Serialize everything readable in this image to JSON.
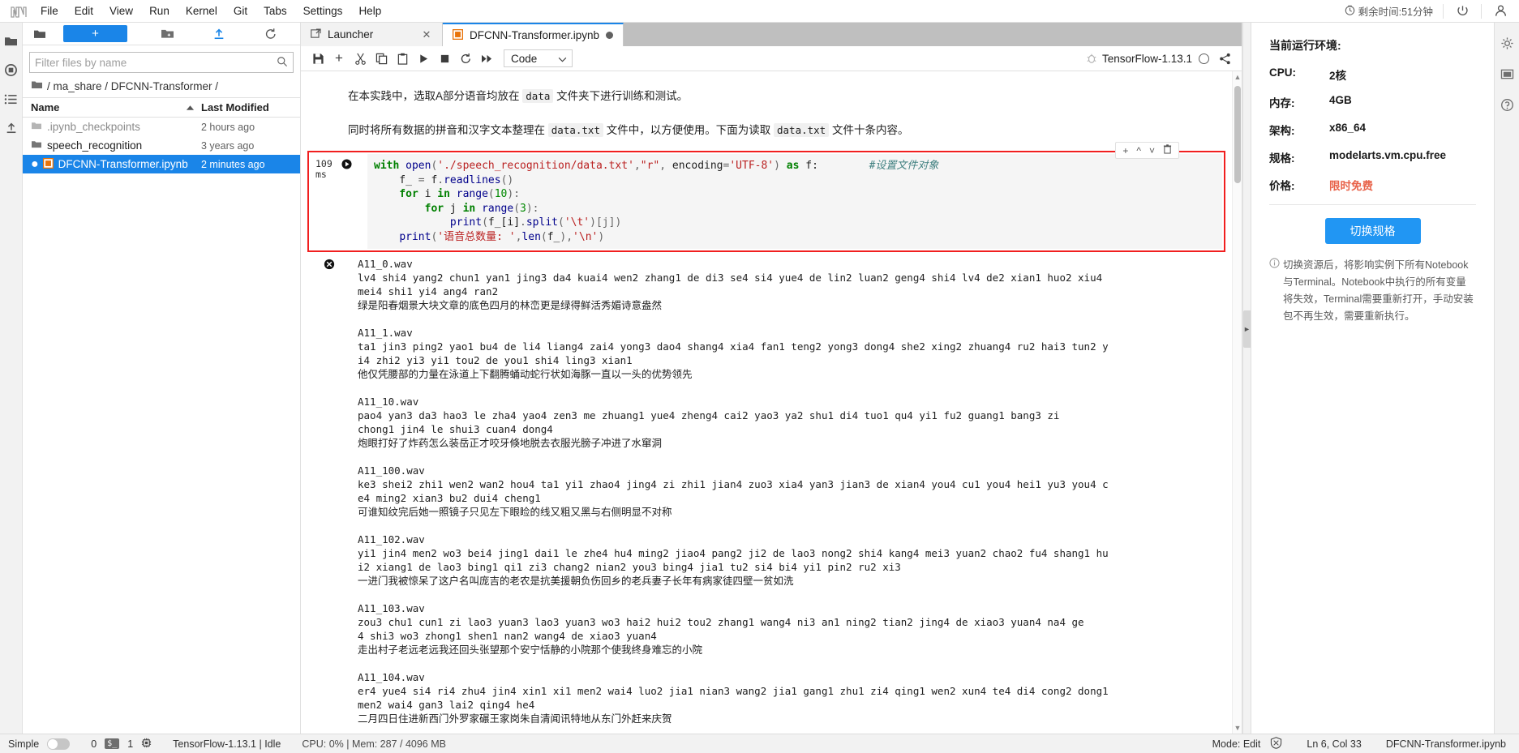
{
  "menubar": {
    "items": [
      "File",
      "Edit",
      "View",
      "Run",
      "Kernel",
      "Git",
      "Tabs",
      "Settings",
      "Help"
    ],
    "timer": "剩余时间:51分钟"
  },
  "filebrowser": {
    "new_button_label": "+",
    "filter_placeholder": "Filter files by name",
    "breadcrumb": "/ ma_share / DFCNN-Transformer /",
    "columns": {
      "name": "Name",
      "modified": "Last Modified"
    },
    "rows": [
      {
        "name": ".ipynb_checkpoints",
        "modified": "2 hours ago",
        "type": "folder",
        "selected": false,
        "dirty": false
      },
      {
        "name": "speech_recognition",
        "modified": "3 years ago",
        "type": "folder",
        "selected": false,
        "dirty": false
      },
      {
        "name": "DFCNN-Transformer.ipynb",
        "modified": "2 minutes ago",
        "type": "notebook",
        "selected": true,
        "dirty": true
      }
    ]
  },
  "tabs": [
    {
      "label": "Launcher",
      "active": false,
      "closable": true
    },
    {
      "label": "DFCNN-Transformer.ipynb",
      "active": true,
      "closable": false,
      "dirty": true
    }
  ],
  "notebook_toolbar": {
    "cell_type": "Code",
    "kernel_name": "TensorFlow-1.13.1"
  },
  "notebook": {
    "markdown_cells": [
      {
        "parts": [
          {
            "t": "text",
            "v": "在本实践中，选取A部分语音均放在 "
          },
          {
            "t": "code",
            "v": "data"
          },
          {
            "t": "text",
            "v": " 文件夹下进行训练和测试。"
          }
        ]
      },
      {
        "parts": [
          {
            "t": "text",
            "v": "同时将所有数据的拼音和汉字文本整理在 "
          },
          {
            "t": "code",
            "v": "data.txt"
          },
          {
            "t": "text",
            "v": " 文件中，以方便使用。下面为读取 "
          },
          {
            "t": "code",
            "v": "data.txt"
          },
          {
            "t": "text",
            "v": " 文件十条内容。"
          }
        ]
      }
    ],
    "code_cell": {
      "exec_time_value": "109",
      "exec_time_unit": "ms",
      "toolbar_icons": [
        "+",
        "^",
        "v",
        "trash"
      ],
      "lines": [
        [
          {
            "t": "kw",
            "v": "with "
          },
          {
            "t": "fn",
            "v": "open"
          },
          {
            "t": "op",
            "v": "("
          },
          {
            "t": "str",
            "v": "'./speech_recognition/data.txt'"
          },
          {
            "t": "op",
            "v": ","
          },
          {
            "t": "str",
            "v": "\"r\""
          },
          {
            "t": "op",
            "v": ", "
          },
          {
            "t": "pl",
            "v": "encoding"
          },
          {
            "t": "op",
            "v": "="
          },
          {
            "t": "str",
            "v": "'UTF-8'"
          },
          {
            "t": "op",
            "v": ") "
          },
          {
            "t": "kw",
            "v": "as"
          },
          {
            "t": "pl",
            "v": " f:"
          },
          {
            "t": "pl",
            "v": "        "
          },
          {
            "t": "cm",
            "v": "#设置文件对象"
          }
        ],
        [
          {
            "t": "pl",
            "v": "    f_ "
          },
          {
            "t": "op",
            "v": "="
          },
          {
            "t": "pl",
            "v": " f"
          },
          {
            "t": "op",
            "v": "."
          },
          {
            "t": "fn",
            "v": "readlines"
          },
          {
            "t": "op",
            "v": "()"
          }
        ],
        [
          {
            "t": "kw",
            "v": "    for"
          },
          {
            "t": "pl",
            "v": " i "
          },
          {
            "t": "kw",
            "v": "in"
          },
          {
            "t": "pl",
            "v": " "
          },
          {
            "t": "fn",
            "v": "range"
          },
          {
            "t": "op",
            "v": "("
          },
          {
            "t": "num",
            "v": "10"
          },
          {
            "t": "op",
            "v": "):"
          }
        ],
        [
          {
            "t": "kw",
            "v": "        for"
          },
          {
            "t": "pl",
            "v": " j "
          },
          {
            "t": "kw",
            "v": "in"
          },
          {
            "t": "pl",
            "v": " "
          },
          {
            "t": "fn",
            "v": "range"
          },
          {
            "t": "op",
            "v": "("
          },
          {
            "t": "num",
            "v": "3"
          },
          {
            "t": "op",
            "v": "):"
          }
        ],
        [
          {
            "t": "pl",
            "v": "            "
          },
          {
            "t": "fn",
            "v": "print"
          },
          {
            "t": "op",
            "v": "("
          },
          {
            "t": "pl",
            "v": "f_[i]"
          },
          {
            "t": "op",
            "v": "."
          },
          {
            "t": "fn",
            "v": "split"
          },
          {
            "t": "op",
            "v": "("
          },
          {
            "t": "str",
            "v": "'\\t'"
          },
          {
            "t": "op",
            "v": ")[j])"
          }
        ],
        [
          {
            "t": "pl",
            "v": "    "
          },
          {
            "t": "fn",
            "v": "print"
          },
          {
            "t": "op",
            "v": "("
          },
          {
            "t": "str",
            "v": "'语音总数量: '"
          },
          {
            "t": "op",
            "v": ","
          },
          {
            "t": "fn",
            "v": "len"
          },
          {
            "t": "op",
            "v": "("
          },
          {
            "t": "pl",
            "v": "f_"
          },
          {
            "t": "op",
            "v": "),"
          },
          {
            "t": "str",
            "v": "'\\n'"
          },
          {
            "t": "op",
            "v": ")"
          }
        ]
      ]
    },
    "output": [
      {
        "wav": "A11_0.wav",
        "pinyin": [
          "lv4 shi4 yang2 chun1 yan1 jing3 da4 kuai4 wen2 zhang1 de di3 se4 si4 yue4 de lin2 luan2 geng4 shi4 lv4 de2 xian1 huo2 xiu4",
          "mei4 shi1 yi4 ang4 ran2"
        ],
        "hanzi": "绿是阳春烟景大块文章的底色四月的林峦更是绿得鲜活秀媚诗意盎然"
      },
      {
        "wav": "A11_1.wav",
        "pinyin": [
          "ta1 jin3 ping2 yao1 bu4 de li4 liang4 zai4 yong3 dao4 shang4 xia4 fan1 teng2 yong3 dong4 she2 xing2 zhuang4 ru2 hai3 tun2 y",
          "i4 zhi2 yi3 yi1 tou2 de you1 shi4 ling3 xian1"
        ],
        "hanzi": "他仅凭腰部的力量在泳道上下翻腾蛹动蛇行状如海豚一直以一头的优势领先"
      },
      {
        "wav": "A11_10.wav",
        "pinyin": [
          "pao4 yan3 da3 hao3 le zha4 yao4 zen3 me zhuang1 yue4 zheng4 cai2 yao3 ya2 shu1 di4 tuo1 qu4 yi1 fu2 guang1 bang3 zi",
          "chong1 jin4 le shui3 cuan4 dong4"
        ],
        "hanzi": "炮眼打好了炸药怎么装岳正才咬牙倏地脱去衣服光膀子冲进了水窜洞"
      },
      {
        "wav": "A11_100.wav",
        "pinyin": [
          "ke3 shei2 zhi1 wen2 wan2 hou4 ta1 yi1 zhao4 jing4 zi zhi1 jian4 zuo3 xia4 yan3 jian3 de xian4 you4 cu1 you4 hei1 yu3 you4 c",
          "e4 ming2 xian3 bu2 dui4 cheng1"
        ],
        "hanzi": "可谁知纹完后她一照镜子只见左下眼睑的线又粗又黑与右侧明显不对称"
      },
      {
        "wav": "A11_102.wav",
        "pinyin": [
          "yi1 jin4 men2 wo3 bei4 jing1 dai1 le zhe4 hu4 ming2 jiao4 pang2 ji2 de lao3 nong2 shi4 kang4 mei3 yuan2 chao2 fu4 shang1 hu",
          "i2 xiang1 de lao3 bing1 qi1 zi3 chang2 nian2 you3 bing4 jia1 tu2 si4 bi4 yi1 pin2 ru2 xi3"
        ],
        "hanzi": "一进门我被惊呆了这户名叫庞吉的老农是抗美援朝负伤回乡的老兵妻子长年有病家徒四壁一贫如洗"
      },
      {
        "wav": "A11_103.wav",
        "pinyin": [
          "zou3 chu1 cun1 zi lao3 yuan3 lao3 yuan3 wo3 hai2 hui2 tou2 zhang1 wang4 ni3 an1 ning2 tian2 jing4 de xiao3 yuan4 na4 ge",
          "4 shi3 wo3 zhong1 shen1 nan2 wang4 de xiao3 yuan4"
        ],
        "hanzi": "走出村子老远老远我还回头张望那个安宁恬静的小院那个使我终身难忘的小院"
      },
      {
        "wav": "A11_104.wav",
        "pinyin": [
          "er4 yue4 si4 ri4 zhu4 jin4 xin1 xi1 men2 wai4 luo2 jia1 nian3 wang2 jia1 gang1 zhu1 zi4 qing1 wen2 xun4 te4 di4 cong2 dong1",
          "men2 wai4 gan3 lai2 qing4 he4"
        ],
        "hanzi": "二月四日住进新西门外罗家碾王家岗朱自清闻讯特地从东门外赶来庆贺"
      }
    ]
  },
  "rightpanel": {
    "title": "当前运行环境:",
    "rows": [
      {
        "key": "CPU:",
        "value": "2核",
        "highlight": false
      },
      {
        "key": "内存:",
        "value": "4GB",
        "highlight": false
      },
      {
        "key": "架构:",
        "value": "x86_64",
        "highlight": false
      },
      {
        "key": "规格:",
        "value": "modelarts.vm.cpu.free",
        "highlight": false
      },
      {
        "key": "价格:",
        "value": "限时免费",
        "highlight": true
      }
    ],
    "switch_button": "切换规格",
    "note": "切换资源后，将影响实例下所有Notebook与Terminal。Notebook中执行的所有变量将失效，Terminal需要重新打开，手动安装包不再生效，需要重新执行。",
    "accent_color": "#2196f3",
    "free_color": "#e8634a"
  },
  "statusbar": {
    "simple_label": "Simple",
    "terminal_count": "0",
    "kernel_count": "1",
    "kernel_status": "TensorFlow-1.13.1 | Idle",
    "resources": "CPU: 0% | Mem: 287 / 4096 MB",
    "mode": "Mode: Edit",
    "cursor": "Ln 6, Col 33",
    "filename": "DFCNN-Transformer.ipynb"
  }
}
